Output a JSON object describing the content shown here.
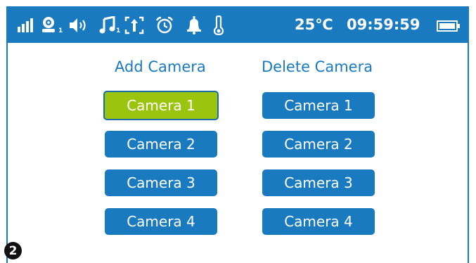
{
  "status_bar": {
    "icons": [
      "signal-icon",
      "camera-user-icon",
      "volume-icon",
      "music-icon",
      "zoom-icon",
      "alarm-clock-icon",
      "bell-icon",
      "thermometer-icon",
      "battery-icon"
    ],
    "camera_sub": "1",
    "music_sub": "1",
    "temperature": "25℃",
    "time": "09:59:59"
  },
  "add_column": {
    "heading": "Add Camera",
    "buttons": [
      "Camera 1",
      "Camera 2",
      "Camera 3",
      "Camera 4"
    ],
    "selected_index": 0
  },
  "delete_column": {
    "heading": "Delete Camera",
    "buttons": [
      "Camera 1",
      "Camera 2",
      "Camera 3",
      "Camera 4"
    ]
  },
  "figure_badge": "2",
  "colors": {
    "accent": "#1a7ac0",
    "selected": "#9bc40e"
  }
}
